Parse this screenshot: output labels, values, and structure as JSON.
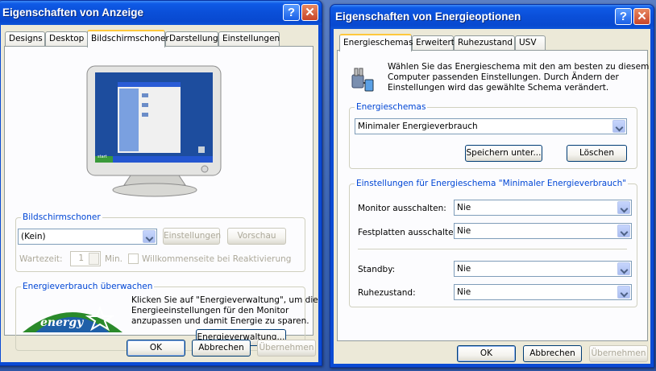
{
  "display_window": {
    "title": "Eigenschaften von Anzeige",
    "help_glyph": "?",
    "close_glyph": "✕",
    "tabs": [
      "Designs",
      "Desktop",
      "Bildschirmschoner",
      "Darstellung",
      "Einstellungen"
    ],
    "active_tab": "Bildschirmschoner",
    "monitor_preview": {
      "icon": "monitor-preview",
      "start_label": "start"
    },
    "screensaver_group": {
      "label": "Bildschirmschoner",
      "selected": "(Kein)",
      "settings_button": "Einstellungen",
      "preview_button": "Vorschau",
      "wait_label": "Wartezeit:",
      "wait_value": "1",
      "wait_unit": "Min.",
      "welcome_checkbox": "Willkommenseite bei Reaktivierung"
    },
    "power_group": {
      "label": "Energieverbrauch überwachen",
      "description_lines": [
        "Klicken Sie auf \"Energieverwaltung\", um die",
        "Energieeinstellungen für den Monitor",
        "anzupassen und damit Energie zu sparen."
      ],
      "logo_text": "energy",
      "power_button": "Energieverwaltung..."
    },
    "ok_button": "OK",
    "cancel_button": "Abbrechen",
    "apply_button": "Übernehmen"
  },
  "power_window": {
    "title": "Eigenschaften von Energieoptionen",
    "help_glyph": "?",
    "close_glyph": "✕",
    "tabs": [
      "Energieschemas",
      "Erweitert",
      "Ruhezustand",
      "USV"
    ],
    "active_tab": "Energieschemas",
    "intro_lines": [
      "Wählen Sie das Energieschema mit den am besten zu diesem",
      "Computer passenden Einstellungen. Durch Ändern der",
      "Einstellungen wird das gewählte Schema verändert."
    ],
    "schemes_group": {
      "label": "Energieschemas",
      "selected": "Minimaler Energieverbrauch",
      "save_button": "Speichern unter...",
      "delete_button": "Löschen"
    },
    "settings_group": {
      "label": "Einstellungen für Energieschema \"Minimaler Energieverbrauch\"",
      "rows": [
        {
          "label": "Monitor ausschalten:",
          "value": "Nie"
        },
        {
          "label": "Festplatten ausschalten:",
          "value": "Nie"
        },
        {
          "label": "Standby:",
          "value": "Nie"
        },
        {
          "label": "Ruhezustand:",
          "value": "Nie"
        }
      ]
    },
    "ok_button": "OK",
    "cancel_button": "Abbrechen",
    "apply_button": "Übernehmen"
  },
  "colors": {
    "titlebar": "#0a4fd8",
    "face": "#ece9d8",
    "group_label": "#0046d5",
    "tab_highlight": "#ffc83c"
  }
}
